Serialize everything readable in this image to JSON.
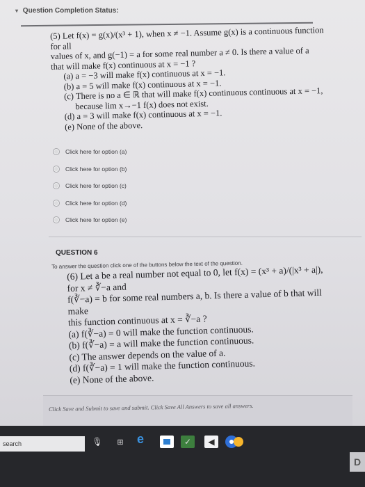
{
  "header": {
    "status_title": "Question Completion Status:"
  },
  "question5": {
    "lines": [
      "(5) Let f(x) = g(x)/(x³ + 1), when x ≠ −1. Assume g(x) is a continuous function for all",
      "values of x, and g(−1) = a for some real number a ≠ 0. Is there a value of a",
      "that will make f(x) continuous at x = −1 ?"
    ],
    "choices": [
      "(a) a = −3 will make f(x) continuous at x = −1.",
      "(b) a = 5 will make f(x) continuous at x = −1.",
      "(c) There is no a ∈ ℝ that will make f(x) continuous continuous at x = −1,",
      "because lim x→−1 f(x) does not exist.",
      "(d) a = 3 will make f(x) continuous at x = −1.",
      "(e) None of the above."
    ]
  },
  "options": [
    {
      "label": "Click here for option (a)"
    },
    {
      "label": "Click here for option (b)"
    },
    {
      "label": "Click here for option (c)"
    },
    {
      "label": "Click here for option (d)"
    },
    {
      "label": "Click here for option (e)"
    }
  ],
  "question6": {
    "title": "QUESTION 6",
    "instruction": "To answer the question click one of the buttons below the text of the question.",
    "lines": [
      "(6) Let a be a real number not equal to 0, let f(x) = (x³ + a)/(|x³ + a|), for x ≠ ∛−a and",
      "f(∛−a) = b for some real numbers a, b. Is there a value of b that will make",
      "this function continuous at x = ∛−a ?"
    ],
    "choices": [
      "(a) f(∛−a) = 0 will make the function continuous.",
      "(b) f(∛−a) = a will make the function continuous.",
      "(c) The answer depends on the value of a.",
      "(d) f(∛−a) = 1 will make the function continuous.",
      "(e) None of the above."
    ]
  },
  "footer": {
    "text": "Click Save and Submit to save and submit. Click Save All Answers to save all answers."
  },
  "taskbar": {
    "search_label": "search"
  },
  "colors": {
    "page_bg": "#e6e5e9",
    "taskbar_bg": "#26272b",
    "edge_blue": "#3a92e0"
  }
}
